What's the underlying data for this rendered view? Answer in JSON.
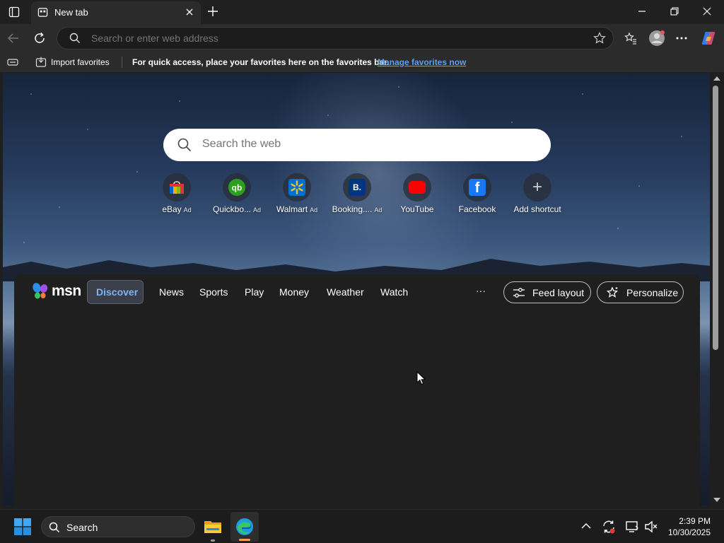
{
  "browser": {
    "tab": {
      "title": "New tab"
    },
    "address_bar": {
      "placeholder": "Search or enter web address"
    },
    "favorites_bar": {
      "import_label": "Import favorites",
      "hint": "For quick access, place your favorites here on the favorites bar.",
      "manage_link": "Manage favorites now"
    }
  },
  "newtab": {
    "search": {
      "placeholder": "Search the web"
    },
    "shortcuts": [
      {
        "label": "eBay",
        "ad": "Ad",
        "icon": "ebay-icon"
      },
      {
        "label": "Quickbo...",
        "ad": "Ad",
        "icon": "quickbooks-icon"
      },
      {
        "label": "Walmart",
        "ad": "Ad",
        "icon": "walmart-icon"
      },
      {
        "label": "Booking....",
        "ad": "Ad",
        "icon": "booking-icon",
        "glyph": "B."
      },
      {
        "label": "YouTube",
        "ad": "",
        "icon": "youtube-icon"
      },
      {
        "label": "Facebook",
        "ad": "",
        "icon": "facebook-icon",
        "glyph": "f"
      },
      {
        "label": "Add shortcut",
        "ad": "",
        "icon": "plus-icon",
        "glyph": "+"
      }
    ],
    "msn": {
      "logo_text": "msn",
      "nav": [
        "Discover",
        "News",
        "Sports",
        "Play",
        "Money",
        "Weather",
        "Watch"
      ],
      "more": "···",
      "feed_layout": "Feed layout",
      "personalize": "Personalize"
    }
  },
  "taskbar": {
    "search_label": "Search",
    "time": "2:39 PM",
    "date": "10/30/2025"
  },
  "colors": {
    "accent_link": "#5aa0f0",
    "msn_panel": "#1f1f1f",
    "toolbar": "#2b2b2b",
    "youtube_red": "#ff0000",
    "quickbooks_green": "#2ca01c",
    "walmart_blue": "#0071ce",
    "booking_blue": "#003580",
    "facebook_blue": "#1877f2"
  }
}
